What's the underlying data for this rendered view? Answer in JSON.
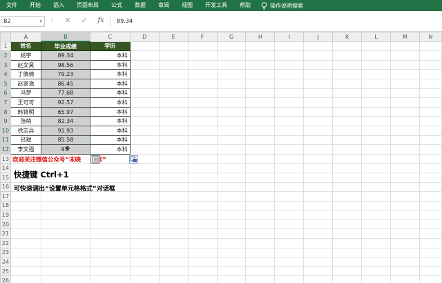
{
  "ribbon": {
    "tabs": [
      "文件",
      "开始",
      "插入",
      "页面布局",
      "公式",
      "数据",
      "审阅",
      "视图",
      "开发工具",
      "帮助"
    ],
    "tell_me": "操作说明搜索",
    "accent": "#217346"
  },
  "formula_bar": {
    "name_box": "B2",
    "fx_label": "fx",
    "value": "89.34"
  },
  "columns": [
    "A",
    "B",
    "C",
    "D",
    "E",
    "F",
    "G",
    "H",
    "I",
    "J",
    "K",
    "L",
    "M",
    "N"
  ],
  "rows": [
    "1",
    "2",
    "3",
    "4",
    "5",
    "6",
    "7",
    "8",
    "9",
    "10",
    "11",
    "12",
    "13",
    "14",
    "15",
    "16",
    "17",
    "18",
    "19",
    "20",
    "21",
    "22",
    "23",
    "24",
    "25",
    "26"
  ],
  "table": {
    "headers": [
      "姓名",
      "毕业成绩",
      "学历"
    ],
    "header_color": "#375623",
    "data": [
      {
        "name": "杨宇",
        "score": "89.34",
        "edu": "本科"
      },
      {
        "name": "赵文昊",
        "score": "98.56",
        "edu": "本科"
      },
      {
        "name": "丁倩倩",
        "score": "79.23",
        "edu": "本科"
      },
      {
        "name": "赵家逸",
        "score": "86.45",
        "edu": "本科"
      },
      {
        "name": "冯梦",
        "score": "77.68",
        "edu": "本科"
      },
      {
        "name": "王可可",
        "score": "92.57",
        "edu": "本科"
      },
      {
        "name": "韩锦明",
        "score": "65.97",
        "edu": "本科"
      },
      {
        "name": "张萌",
        "score": "82.34",
        "edu": "本科"
      },
      {
        "name": "徐志兵",
        "score": "91.93",
        "edu": "本科"
      },
      {
        "name": "吕斌",
        "score": "85.58",
        "edu": "本科"
      },
      {
        "name": "李文强",
        "score": "93.",
        "edu": "本科"
      }
    ]
  },
  "notes": {
    "promo": "欢迎关注微信公众号“末晓",
    "promo_tail": "间室”",
    "promo_color": "#e00000",
    "shortcut_title": "快捷键 Ctrl+1",
    "shortcut_desc": "可快速调出“设置单元格格式”对话框"
  }
}
